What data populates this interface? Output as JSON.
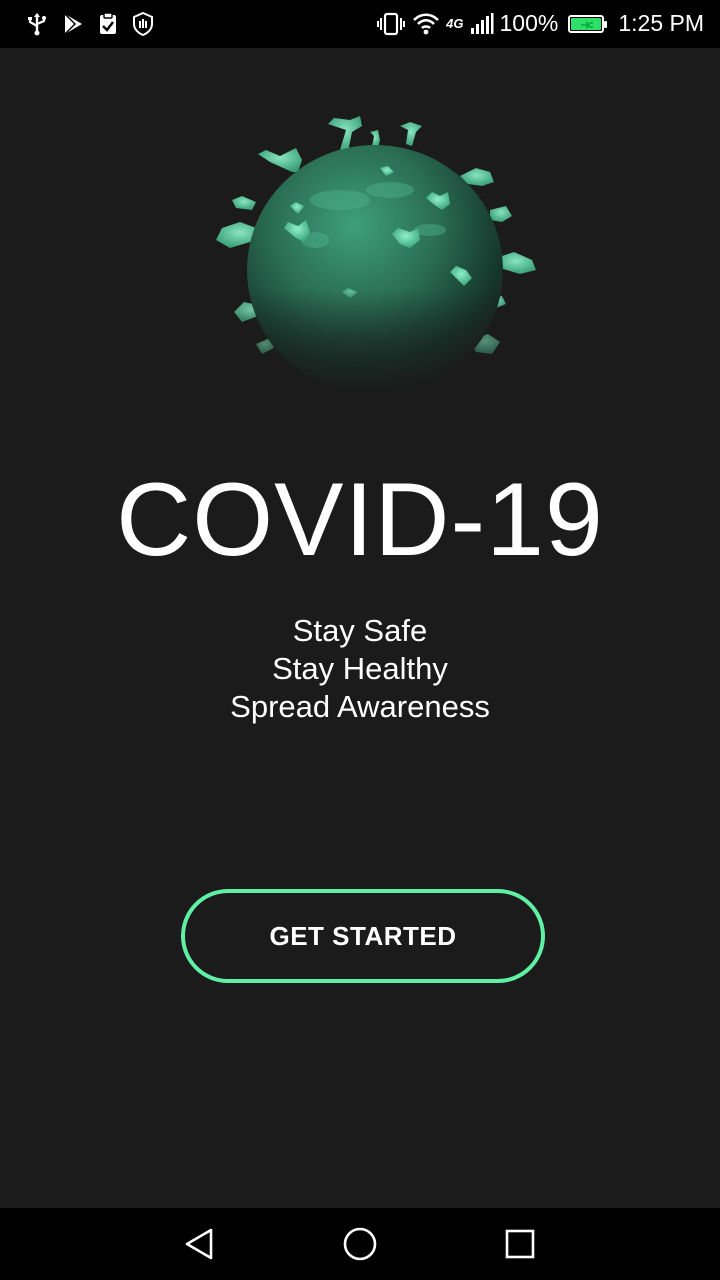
{
  "status_bar": {
    "battery_text": "100%",
    "time": "1:25 PM",
    "network_label": "4G",
    "icons": [
      "usb-icon",
      "play-store-icon",
      "clipboard-check-icon",
      "shield-hand-icon",
      "vibrate-icon",
      "wifi-icon",
      "cell-signal-icon",
      "battery-charging-icon"
    ],
    "battery_color": "#2ee06a"
  },
  "hero": {
    "image": "virus-illustration",
    "title": "COVID-19",
    "taglines": [
      "Stay Safe",
      "Stay Healthy",
      "Spread Awareness"
    ]
  },
  "cta": {
    "label": "GET STARTED",
    "border_color": "#5ff0a6"
  },
  "nav_bar": {
    "buttons": [
      "back-icon",
      "home-icon",
      "recents-icon"
    ]
  },
  "theme": {
    "background": "#1b1b1b",
    "accent": "#5ff0a6",
    "virus_color": "#3aa57e"
  }
}
